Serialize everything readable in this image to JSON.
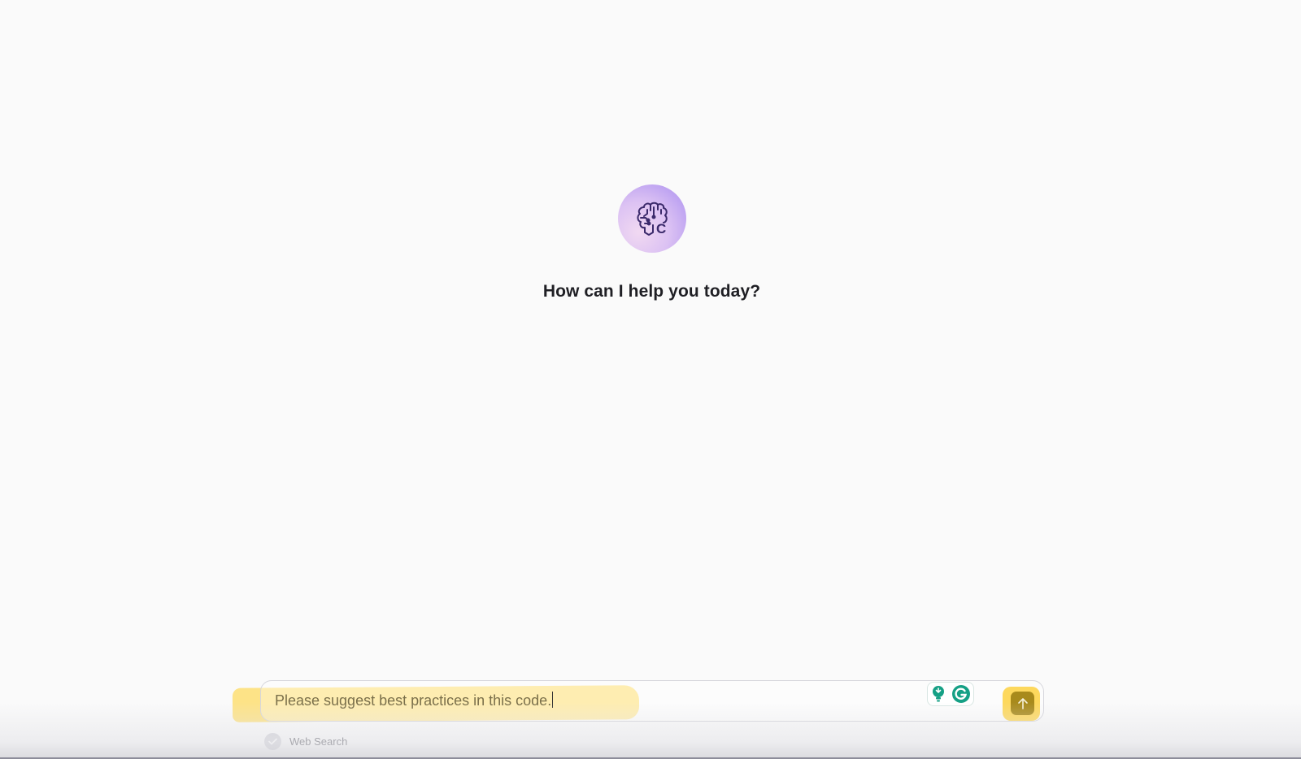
{
  "hero": {
    "logo_icon": "brain-circuit-icon",
    "logo_letter": "C",
    "greeting": "How can I help you today?"
  },
  "composer": {
    "input_value": "Please suggest best practices in this code.",
    "send_icon": "arrow-up-icon",
    "extension_icons": [
      "lightbulb-icon",
      "grammarly-icon"
    ]
  },
  "options": {
    "web_search_label": "Web Search",
    "web_search_icon": "check-icon"
  },
  "colors": {
    "background": "#fafafa",
    "highlight": "#fde07a",
    "send_button": "#a88a1c",
    "logo_gradient_start": "#f1d9f2",
    "logo_gradient_end": "#a98ef0",
    "logo_stroke": "#3b2a6b",
    "grammarly": "#15a085"
  }
}
